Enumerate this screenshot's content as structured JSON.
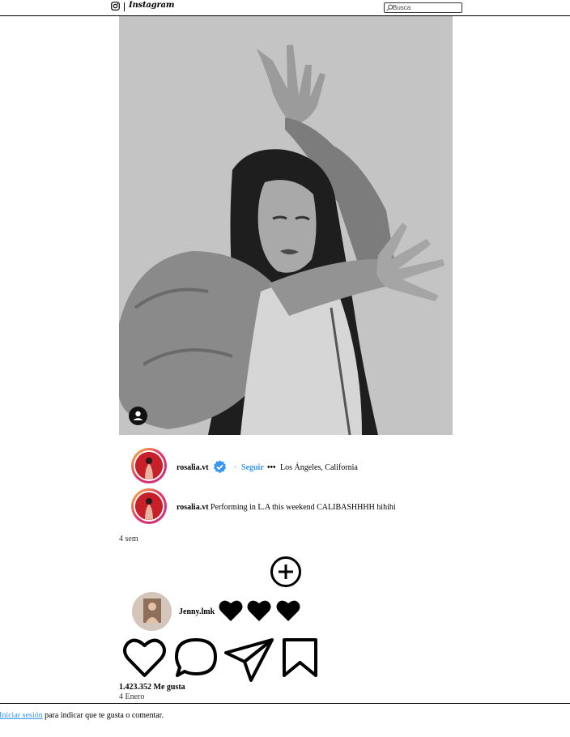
{
  "header": {
    "wordmark": "Instagram",
    "search_placeholder": "Busca"
  },
  "post": {
    "image_alt": "",
    "author": "rosalia.vt",
    "follow_label": "Seguir",
    "dot_separator": "·",
    "more": "•••",
    "location": "Los Ángeles, California",
    "caption_author": "rosalia.vt",
    "caption_text": "Performing in L.A this weekend CALIBASHHHH hihihi",
    "time_ago": "4 sem",
    "likes": "1.423.352 Me gusta",
    "date": "4 Enero"
  },
  "comment": {
    "author": "Jenny.lmk"
  },
  "footer": {
    "login_link": "Iniciar sesión",
    "login_text": " para indicar que te gusta o comentar."
  },
  "colors": {
    "accent": "#3897f0",
    "avatar_red": "#c8202a",
    "ring_start": "#f9c33a",
    "ring_end": "#c13584"
  },
  "icons": [
    "instagram-icon",
    "search-icon",
    "user-tag-icon",
    "verified-icon",
    "plus-circle-icon",
    "heart-icon",
    "comment-icon",
    "share-icon",
    "bookmark-icon"
  ]
}
